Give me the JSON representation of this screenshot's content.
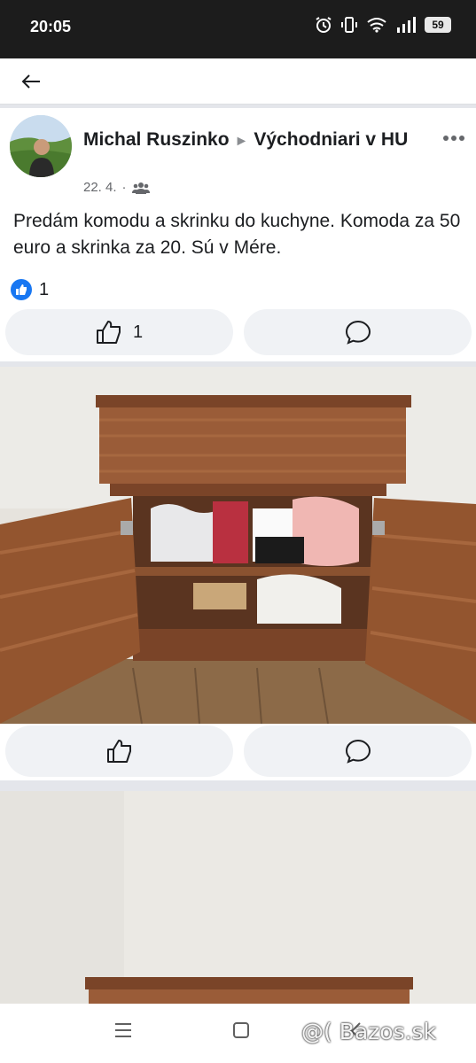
{
  "status_bar": {
    "time": "20:05",
    "battery": "59",
    "icons": [
      "alarm-icon",
      "vibrate-icon",
      "wifi-icon",
      "signal-icon",
      "battery-icon"
    ]
  },
  "post": {
    "author": "Michal Ruszinko",
    "group": "Východniari v HU",
    "date": "22. 4.",
    "separator": "·",
    "text": "Predám komodu a skrinku do kuchyne. Komoda za 50 euro a skrinka za 20. Sú v Mére.",
    "reaction_count": "1",
    "like_count": "1"
  },
  "watermark": "@( Bazos.sk",
  "colors": {
    "accent": "#1877f2",
    "wood": "#8a4f2c"
  }
}
